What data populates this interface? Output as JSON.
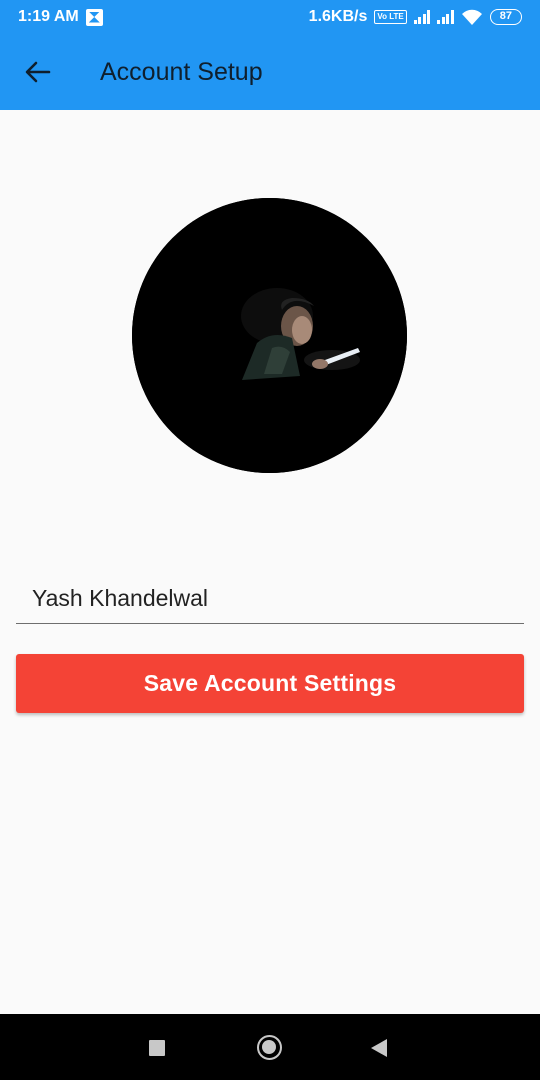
{
  "status_bar": {
    "time": "1:19 AM",
    "network_speed": "1.6KB/s",
    "volte": "Vo LTE",
    "battery": "87",
    "icons": [
      "notification-icon",
      "volte-icon",
      "signal-icon",
      "signal-icon",
      "wifi-icon",
      "battery-icon"
    ]
  },
  "app_bar": {
    "title": "Account Setup",
    "back_icon": "arrow-left-icon"
  },
  "form": {
    "name_value": "Yash Khandelwal",
    "save_label": "Save Account Settings"
  },
  "nav_bar": {
    "icons": [
      "recents-icon",
      "home-icon",
      "back-icon"
    ]
  },
  "colors": {
    "primary": "#2196f3",
    "accent": "#f44336",
    "background": "#fafafa"
  }
}
